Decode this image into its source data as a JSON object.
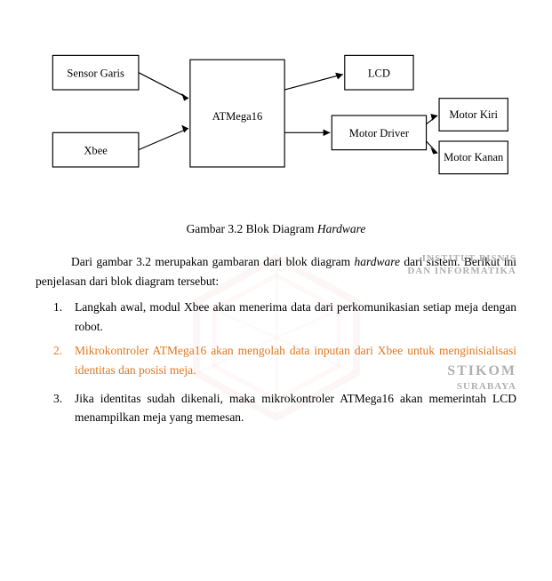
{
  "diagram": {
    "caption": "Gambar 3.2 Blok Diagram ",
    "caption_italic": "Hardware",
    "boxes": {
      "sensor_garis": "Sensor Garis",
      "xbee": "Xbee",
      "atmega": "ATMega16",
      "lcd": "LCD",
      "motor_driver": "Motor Driver",
      "motor_kiri": "Motor Kiri",
      "motor_kanan": "Motor Kanan"
    }
  },
  "body": {
    "paragraph1": "Dari gambar 3.2 merupakan gambaran dari blok diagram hardware dari sistem. Berikut ini penjelasan dari blok diagram tersebut:",
    "items": [
      {
        "num": "1.",
        "text": "Langkah awal, modul Xbee akan menerima data dari perkomunikasian setiap meja dengan robot."
      },
      {
        "num": "2.",
        "text": "Mikrokontroler ATMega16 akan mengolah data inputan dari Xbee untuk menginisialisasi identitas dan posisi meja."
      },
      {
        "num": "3.",
        "text": "Jika identitas sudah dikenali, maka mikrokontroler ATMega16 akan memerintah LCD menampilkan meja yang memesan."
      }
    ]
  },
  "watermark": {
    "inst_line1": "INSTITUT BISNIS",
    "inst_line2": "DAN INFORMATIKA",
    "inst_line3": "STIKOM",
    "inst_line4": "SURABAYA"
  }
}
